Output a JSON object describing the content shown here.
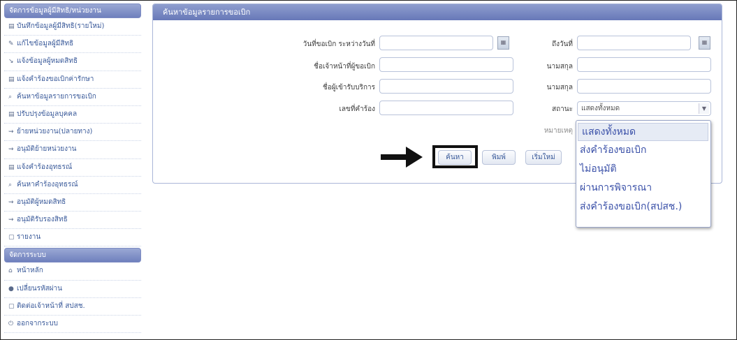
{
  "sidebar": {
    "section1_title": "จัดการข้อมูลผู้มีสิทธิ/หน่วยงาน",
    "items1": [
      {
        "icon": "▤",
        "label": "บันทึกข้อมูลผู้มีสิทธิ(รายใหม่)"
      },
      {
        "icon": "✎",
        "label": "แก้ไขข้อมูลผู้มีสิทธิ"
      },
      {
        "icon": "↘",
        "label": "แจ้งข้อมูลผู้หมดสิทธิ"
      },
      {
        "icon": "▤",
        "label": "แจ้งคำร้องขอเบิกค่ารักษา"
      },
      {
        "icon": "⌕",
        "label": "ค้นหาข้อมูลรายการขอเบิก"
      },
      {
        "icon": "▤",
        "label": "ปรับปรุงข้อมูลบุคคล"
      },
      {
        "icon": "⇝",
        "label": "ย้ายหน่วยงาน(ปลายทาง)"
      },
      {
        "icon": "⇝",
        "label": "อนุมัติย้ายหน่วยงาน"
      },
      {
        "icon": "▤",
        "label": "แจ้งคำร้องอุทธรณ์"
      },
      {
        "icon": "⌕",
        "label": "ค้นหาคำร้องอุทธรณ์"
      },
      {
        "icon": "⇝",
        "label": "อนุมัติผู้หมดสิทธิ"
      },
      {
        "icon": "⇝",
        "label": "อนุมัติรับรองสิทธิ"
      },
      {
        "icon": "▢",
        "label": "รายงาน"
      }
    ],
    "section2_title": "จัดการระบบ",
    "items2": [
      {
        "icon": "⌂",
        "label": "หน้าหลัก"
      },
      {
        "icon": "●",
        "label": "เปลี่ยนรหัสผ่าน"
      },
      {
        "icon": "▢",
        "label": "ติดต่อเจ้าหน้าที่ สปสช."
      },
      {
        "icon": "⏻",
        "label": "ออกจากระบบ"
      }
    ]
  },
  "panel": {
    "title": "ค้นหาข้อมูลรายการขอเบิก",
    "labels": {
      "date_from": "วันที่ขอเบิก ระหว่างวันที่",
      "date_to": "ถึงวันที่",
      "officer_name": "ชื่อเจ้าหน้าที่ผู้ขอเบิก",
      "officer_surname": "นามสกุล",
      "recipient_name": "ชื่อผู้เข้ารับบริการ",
      "recipient_surname": "นามสกุล",
      "request_no": "เลขที่คำร้อง",
      "status": "สถานะ",
      "remark": "หมายเหตุ"
    },
    "status_value": "แสดงทั้งหมด",
    "status_options": [
      "แสดงทั้งหมด",
      "ส่งคำร้องขอเบิก",
      "ไม่อนุมัติ",
      "ผ่านการพิจารณา",
      "ส่งคำร้องขอเบิก(สปสช.)"
    ],
    "buttons": {
      "search": "ค้นหา",
      "print": "พิมพ์",
      "reset": "เริ่มใหม่"
    }
  }
}
